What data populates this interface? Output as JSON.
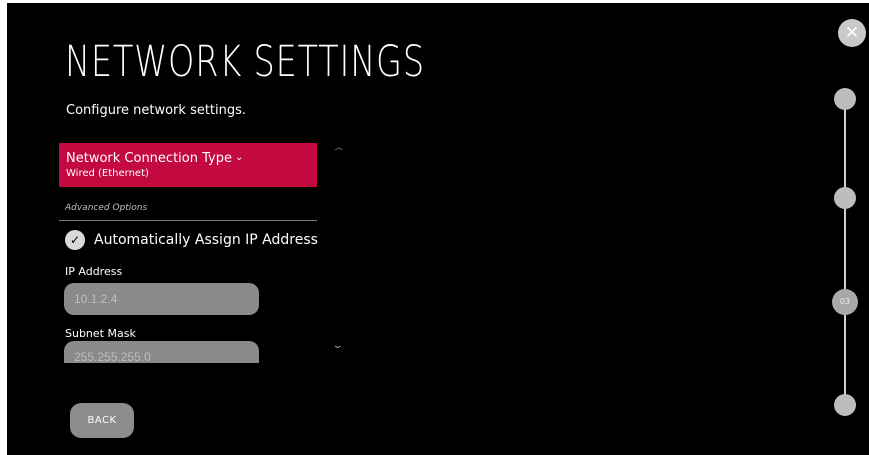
{
  "header": {
    "title": "NETWORK SETTINGS",
    "subtitle": "Configure network settings.",
    "close_icon": "close-icon"
  },
  "connection_type": {
    "label": "Network Connection Type",
    "chevron": "⌄",
    "value": "Wired (Ethernet)"
  },
  "advanced": {
    "section_label": "Advanced Options",
    "auto_assign": {
      "label": "Automatically Assign IP Address",
      "checked": true,
      "check_glyph": "✓"
    },
    "ip_address": {
      "label": "IP Address",
      "value": "10.1.2.4"
    },
    "subnet_mask": {
      "label": "Subnet Mask",
      "value": "255.255.255.0"
    }
  },
  "scroll": {
    "up_glyph": "^",
    "down_glyph": "⌄"
  },
  "footer": {
    "back_label": "BACK"
  },
  "stepper": {
    "current_step_label": "03",
    "total_steps": 4,
    "current_step": 3
  },
  "colors": {
    "accent": "#c3093f",
    "background": "#000000",
    "input_bg": "#8a8a8a",
    "stepper": "#bdbdbd"
  }
}
